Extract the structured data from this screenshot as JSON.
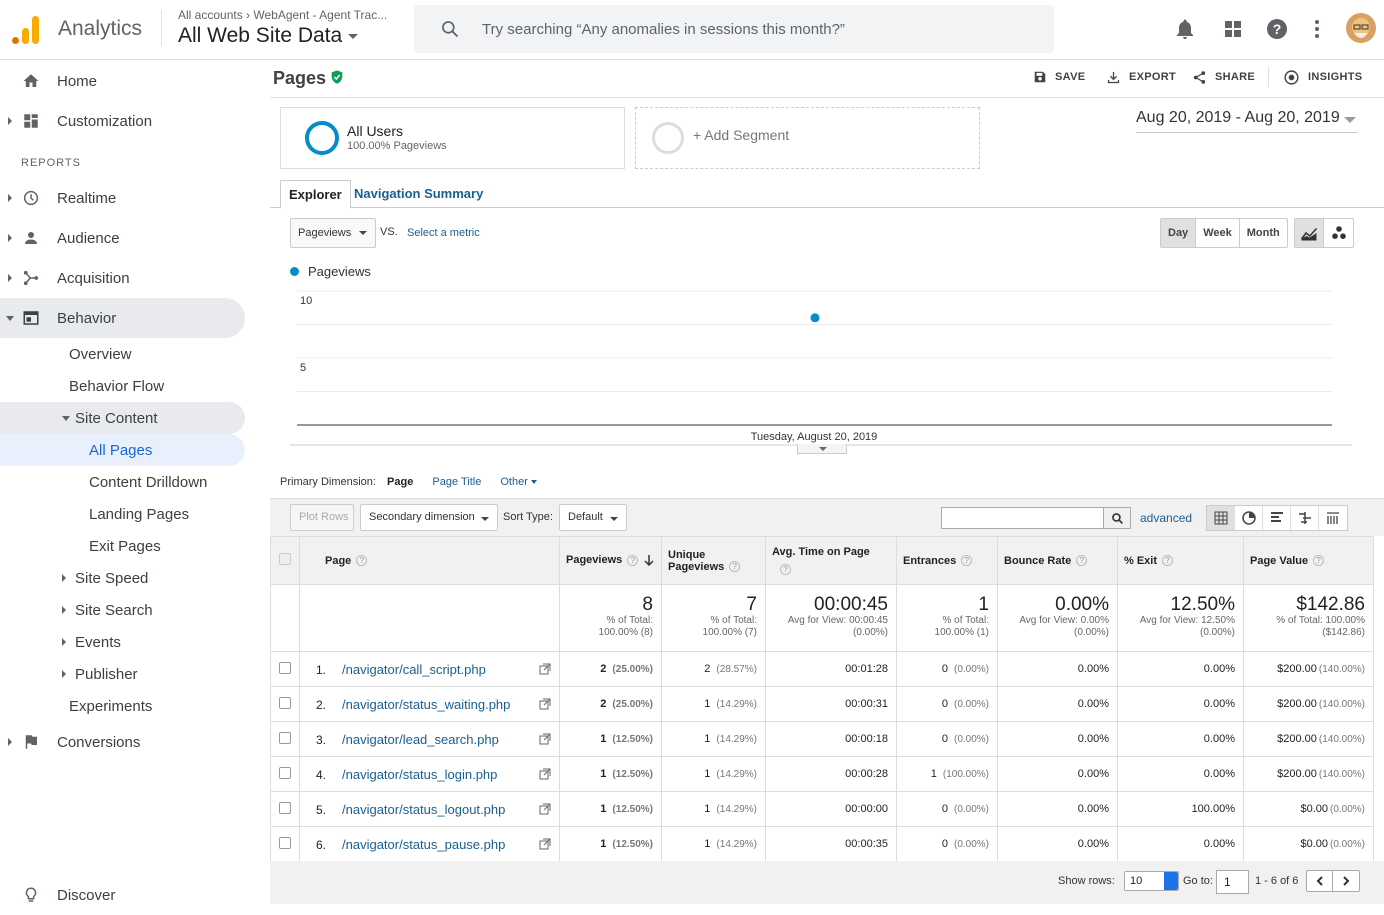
{
  "app": {
    "name": "Analytics",
    "account_crumb": "All accounts › WebAgent - Agent Trac...",
    "view_name": "All Web Site Data",
    "search_placeholder": "Try searching “Any anomalies in sessions this month?”"
  },
  "sidebar": {
    "home": "Home",
    "customization": "Customization",
    "reports_header": "REPORTS",
    "realtime": "Realtime",
    "audience": "Audience",
    "acquisition": "Acquisition",
    "behavior": "Behavior",
    "overview": "Overview",
    "behavior_flow": "Behavior Flow",
    "site_content": "Site Content",
    "all_pages": "All Pages",
    "content_drilldown": "Content Drilldown",
    "landing_pages": "Landing Pages",
    "exit_pages": "Exit Pages",
    "site_speed": "Site Speed",
    "site_search": "Site Search",
    "events": "Events",
    "publisher": "Publisher",
    "experiments": "Experiments",
    "conversions": "Conversions",
    "discover": "Discover"
  },
  "header": {
    "title": "Pages",
    "save": "SAVE",
    "export": "EXPORT",
    "share": "SHARE",
    "insights": "INSIGHTS"
  },
  "segments": {
    "all_users": "All Users",
    "all_users_pct": "100.00% Pageviews",
    "add_segment": "+ Add Segment"
  },
  "date_range": "Aug 20, 2019 - Aug 20, 2019",
  "tabs": {
    "explorer": "Explorer",
    "nav_summary": "Navigation Summary"
  },
  "chart_controls": {
    "metric": "Pageviews",
    "vs": "VS.",
    "select_metric": "Select a metric",
    "day": "Day",
    "week": "Week",
    "month": "Month"
  },
  "chart_data": {
    "type": "line",
    "series": [
      {
        "name": "Pageviews",
        "values": [
          8
        ]
      }
    ],
    "x": [
      "Tuesday, August 20, 2019"
    ],
    "y_ticks": [
      "10",
      "5"
    ],
    "ylim": [
      0,
      10
    ],
    "color": "#058dc7"
  },
  "dimension": {
    "label": "Primary Dimension:",
    "page": "Page",
    "page_title": "Page Title",
    "other": "Other"
  },
  "toolbar": {
    "plot_rows": "Plot Rows",
    "secondary": "Secondary dimension",
    "sort_type_label": "Sort Type:",
    "sort_type": "Default",
    "advanced": "advanced"
  },
  "table": {
    "headers": {
      "page": "Page",
      "pageviews": "Pageviews",
      "unique_pageviews": "Unique Pageviews",
      "avg_time": "Avg. Time on Page",
      "entrances": "Entrances",
      "bounce_rate": "Bounce Rate",
      "exit": "% Exit",
      "page_value": "Page Value"
    },
    "totals": {
      "pageviews": "8",
      "pageviews_sub1": "% of Total:",
      "pageviews_sub2": "100.00% (8)",
      "unique": "7",
      "unique_sub1": "% of Total:",
      "unique_sub2": "100.00% (7)",
      "avg_time": "00:00:45",
      "avg_time_sub1": "Avg for View: 00:00:45",
      "avg_time_sub2": "(0.00%)",
      "entrances": "1",
      "entrances_sub1": "% of Total:",
      "entrances_sub2": "100.00% (1)",
      "bounce": "0.00%",
      "bounce_sub1": "Avg for View: 0.00%",
      "bounce_sub2": "(0.00%)",
      "exit": "12.50%",
      "exit_sub1": "Avg for View: 12.50%",
      "exit_sub2": "(0.00%)",
      "value": "$142.86",
      "value_sub1": "% of Total: 100.00%",
      "value_sub2": "($142.86)"
    },
    "rows": [
      {
        "idx": "1.",
        "page": "/navigator/call_script.php",
        "pv": "2",
        "pv_pct": "(25.00%)",
        "upv": "2",
        "upv_pct": "(28.57%)",
        "time": "00:01:28",
        "ent": "0",
        "ent_pct": "(0.00%)",
        "bounce": "0.00%",
        "exit": "0.00%",
        "val": "$200.00",
        "val_pct": "(140.00%)"
      },
      {
        "idx": "2.",
        "page": "/navigator/status_waiting.php",
        "pv": "2",
        "pv_pct": "(25.00%)",
        "upv": "1",
        "upv_pct": "(14.29%)",
        "time": "00:00:31",
        "ent": "0",
        "ent_pct": "(0.00%)",
        "bounce": "0.00%",
        "exit": "0.00%",
        "val": "$200.00",
        "val_pct": "(140.00%)"
      },
      {
        "idx": "3.",
        "page": "/navigator/lead_search.php",
        "pv": "1",
        "pv_pct": "(12.50%)",
        "upv": "1",
        "upv_pct": "(14.29%)",
        "time": "00:00:18",
        "ent": "0",
        "ent_pct": "(0.00%)",
        "bounce": "0.00%",
        "exit": "0.00%",
        "val": "$200.00",
        "val_pct": "(140.00%)"
      },
      {
        "idx": "4.",
        "page": "/navigator/status_login.php",
        "pv": "1",
        "pv_pct": "(12.50%)",
        "upv": "1",
        "upv_pct": "(14.29%)",
        "time": "00:00:28",
        "ent": "1",
        "ent_pct": "(100.00%)",
        "bounce": "0.00%",
        "exit": "0.00%",
        "val": "$200.00",
        "val_pct": "(140.00%)"
      },
      {
        "idx": "5.",
        "page": "/navigator/status_logout.php",
        "pv": "1",
        "pv_pct": "(12.50%)",
        "upv": "1",
        "upv_pct": "(14.29%)",
        "time": "00:00:00",
        "ent": "0",
        "ent_pct": "(0.00%)",
        "bounce": "0.00%",
        "exit": "100.00%",
        "val": "$0.00",
        "val_pct": "(0.00%)"
      },
      {
        "idx": "6.",
        "page": "/navigator/status_pause.php",
        "pv": "1",
        "pv_pct": "(12.50%)",
        "upv": "1",
        "upv_pct": "(14.29%)",
        "time": "00:00:35",
        "ent": "0",
        "ent_pct": "(0.00%)",
        "bounce": "0.00%",
        "exit": "0.00%",
        "val": "$0.00",
        "val_pct": "(0.00%)"
      }
    ]
  },
  "footer": {
    "show_rows": "Show rows:",
    "rows_value": "10",
    "go_to": "Go to:",
    "go_to_value": "1",
    "range": "1 - 6 of 6"
  }
}
